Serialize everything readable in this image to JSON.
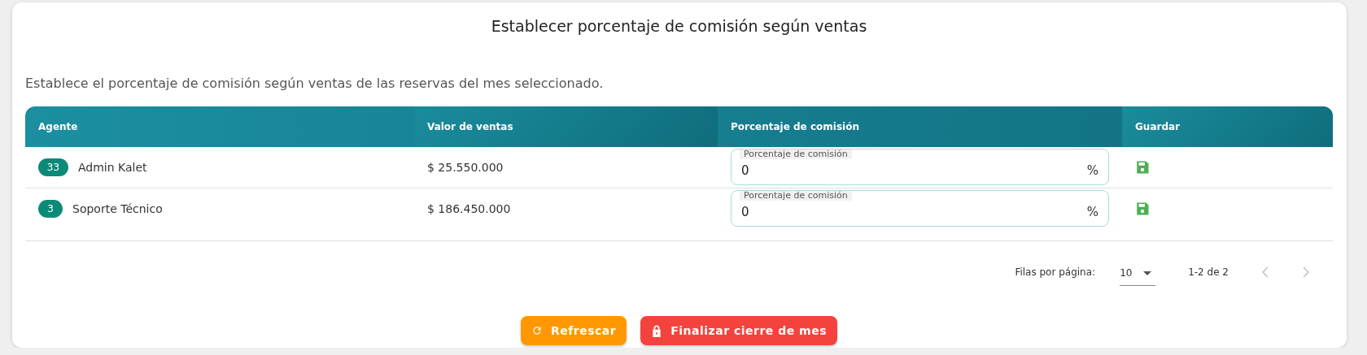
{
  "title": "Establecer porcentaje de comisión según ventas",
  "description": "Establece el porcentaje de comisión según ventas de las reservas del mes seleccionado.",
  "table": {
    "columns": [
      "Agente",
      "Valor de ventas",
      "Porcentaje de comisión",
      "Guardar"
    ],
    "rows": [
      {
        "badge": "33",
        "agent": "Admin Kalet",
        "sales": "$ 25.550.000",
        "field_label": "Porcentaje de comisión",
        "value": "0",
        "suffix": "%"
      },
      {
        "badge": "3",
        "agent": "Soporte Técnico",
        "sales": "$ 186.450.000",
        "field_label": "Porcentaje de comisión",
        "value": "0",
        "suffix": "%"
      }
    ]
  },
  "pagination": {
    "rows_label": "Filas por página:",
    "rows_per_page": "10",
    "range": "1-2 de 2",
    "prev_disabled": true,
    "next_disabled": true
  },
  "buttons": [
    {
      "kind": "refresh",
      "label": "Refrescar"
    },
    {
      "kind": "lock",
      "label": "Finalizar cierre de mes"
    }
  ]
}
